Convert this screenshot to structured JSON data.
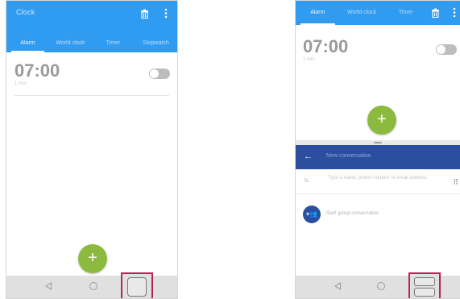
{
  "left_panel": {
    "header": {
      "title": "Clock",
      "delete_icon": "trash-icon",
      "more_icon": "more-vert-icon"
    },
    "tabs": [
      {
        "label": "Alarm",
        "active": true
      },
      {
        "label": "World clock",
        "active": false
      },
      {
        "label": "Timer",
        "active": false
      },
      {
        "label": "Stopwatch",
        "active": false
      }
    ],
    "alarm": {
      "time": "07:00",
      "subtitle": "1 min",
      "enabled": false
    },
    "fab_label": "+",
    "navbar": {
      "back_icon": "back-triangle-icon",
      "home_icon": "home-circle-icon",
      "recents_icon": "recents-square-icon"
    }
  },
  "right_panel": {
    "clock_header": {
      "tabs": [
        {
          "label": "Alarm",
          "active": true
        },
        {
          "label": "World clock",
          "active": false
        },
        {
          "label": "Timer",
          "active": false
        }
      ],
      "delete_icon": "trash-icon",
      "more_icon": "more-vert-icon"
    },
    "alarm": {
      "time": "07:00",
      "subtitle": "1 min",
      "enabled": false
    },
    "fab_label": "+",
    "messaging": {
      "back_label": "←",
      "title": "New conversation",
      "to_label": "To",
      "to_placeholder": "Type a name, phone number or email address",
      "dialpad_glyph": "⠿",
      "group_avatar_label": "+👥",
      "group_label": "Start group conversation"
    },
    "navbar": {
      "back_icon": "back-triangle-icon",
      "home_icon": "home-circle-icon",
      "split_icon": "split-screen-icon"
    }
  },
  "colors": {
    "clock_accent": "#2f9cf2",
    "messaging_accent": "#2b4f9e",
    "fab": "#8cba3f",
    "highlight": "#b6245a"
  }
}
